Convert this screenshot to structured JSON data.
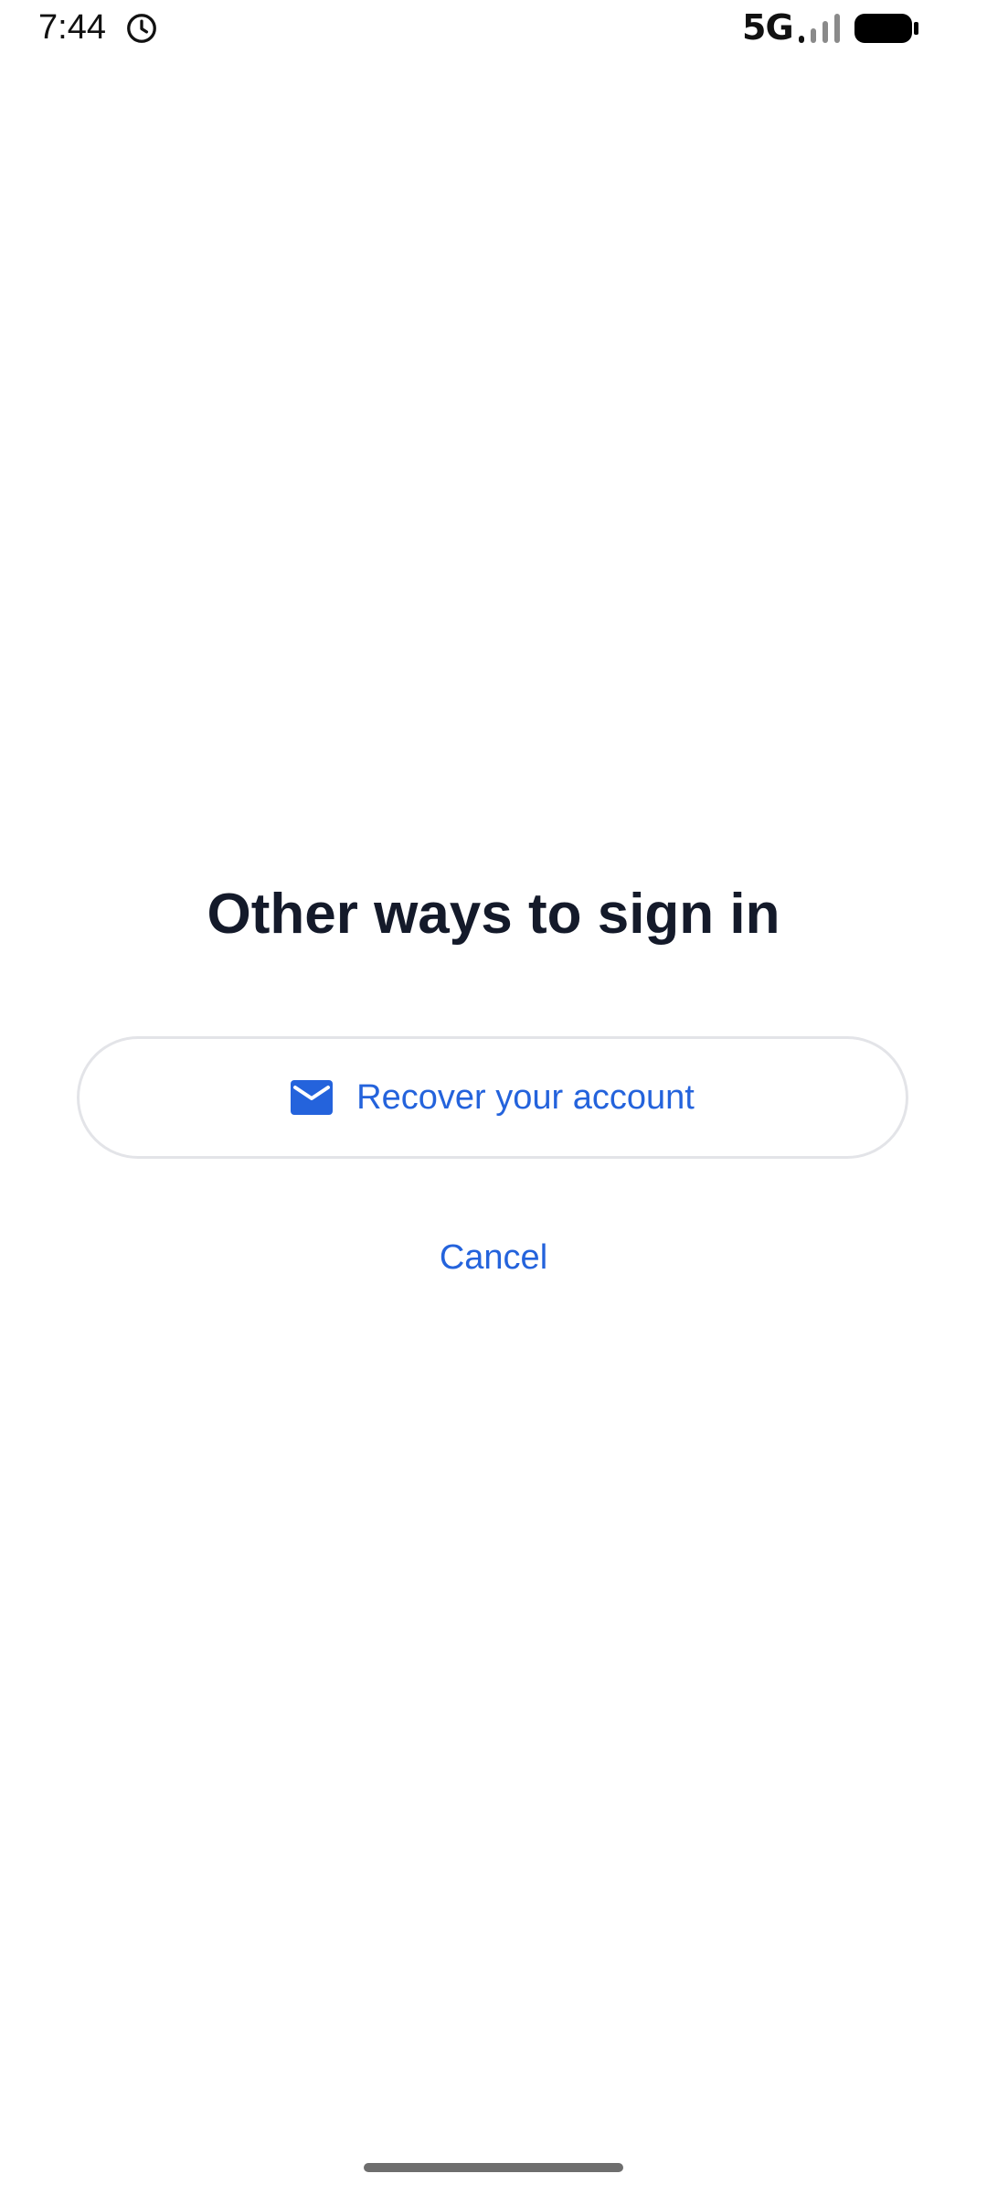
{
  "status_bar": {
    "time": "7:44",
    "network": "5G",
    "alarm_icon": "alarm-clock-icon",
    "signal_icon": "signal-strength-icon",
    "battery_icon": "battery-icon"
  },
  "main": {
    "title": "Other ways to sign in",
    "recover_button": {
      "label": "Recover your account",
      "icon": "mail-icon"
    },
    "cancel_label": "Cancel"
  },
  "colors": {
    "accent": "#2463dc",
    "title": "#141a2a",
    "button_border": "#e3e4e8",
    "background": "#ffffff"
  }
}
